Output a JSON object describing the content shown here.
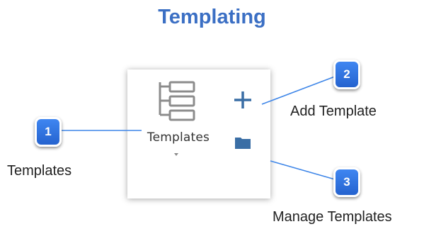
{
  "title": "Templating",
  "ribbon": {
    "templates_label": "Templates",
    "templates_icon": "hierarchy-list-icon",
    "add_icon": "plus-icon",
    "manage_icon": "folder-icon"
  },
  "callouts": [
    {
      "number": "1",
      "text": "Templates"
    },
    {
      "number": "2",
      "text": "Add Template"
    },
    {
      "number": "3",
      "text": "Manage Templates"
    }
  ],
  "colors": {
    "title": "#3b6fc4",
    "badge": "#2f74e0",
    "leader_line": "#3e86e8",
    "icon_accent": "#3a6ea5",
    "icon_gray": "#8c8c8c"
  }
}
